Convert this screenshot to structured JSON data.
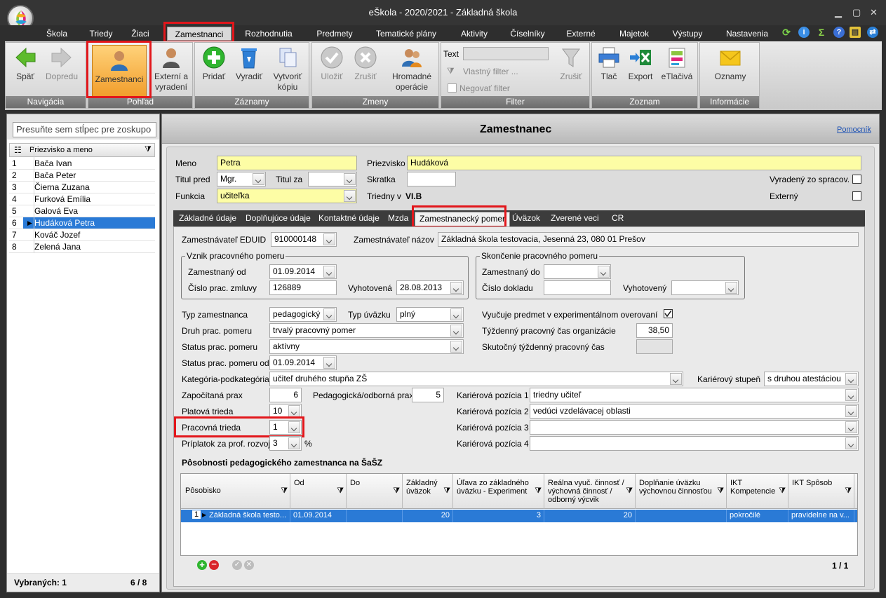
{
  "window": {
    "title": "eŠkola - 2020/2021 - Základná škola"
  },
  "menu": [
    "Škola",
    "Triedy",
    "Žiaci",
    "Zamestnanci",
    "Rozhodnutia",
    "Predmety",
    "Tematické plány",
    "Aktivity",
    "Číselníky",
    "Externé",
    "Majetok",
    "Výstupy",
    "Nastavenia"
  ],
  "ribbon": {
    "groups": [
      "Navigácia",
      "Pohľad",
      "Záznamy",
      "Zmeny",
      "Filter",
      "Zoznam",
      "Informácie"
    ],
    "back": "Späť",
    "forward": "Dopredu",
    "employees": "Zamestnanci",
    "external_line1": "Externí a",
    "external_line2": "vyradení",
    "add": "Pridať",
    "remove": "Vyradiť",
    "copy_line1": "Vytvoriť",
    "copy_line2": "kópiu",
    "save": "Uložiť",
    "cancel": "Zrušiť",
    "mass_line1": "Hromadné",
    "mass_line2": "operácie",
    "filter_text_label": "Text",
    "custom_filter": "Vlastný filter ...",
    "negate_filter": "Negovať filter",
    "filter_cancel": "Zrušiť",
    "print": "Tlač",
    "export": "Export",
    "eforms": "eTlačivá",
    "notices": "Oznamy"
  },
  "left": {
    "group_placeholder": "Presuňte sem stĺpec pre zoskupo",
    "column": "Priezvisko a meno",
    "rows": [
      {
        "n": "1",
        "name": "Bača Ivan"
      },
      {
        "n": "2",
        "name": "Bača Peter"
      },
      {
        "n": "3",
        "name": "Čierna Zuzana"
      },
      {
        "n": "4",
        "name": "Furková Emília"
      },
      {
        "n": "5",
        "name": "Galová Eva"
      },
      {
        "n": "6",
        "name": "Hudáková Petra"
      },
      {
        "n": "7",
        "name": "Kováč Jozef"
      },
      {
        "n": "8",
        "name": "Zelená Jana"
      }
    ],
    "selected_label": "Vybraných: 1",
    "count": "6 / 8"
  },
  "main": {
    "title": "Zamestnanec",
    "help": "Pomocník",
    "meno_label": "Meno",
    "meno": "Petra",
    "priezvisko_label": "Priezvisko",
    "priezvisko": "Hudáková",
    "titul_pred_label": "Titul pred",
    "titul_pred": "Mgr.",
    "titul_za_label": "Titul za",
    "titul_za": "",
    "skratka_label": "Skratka",
    "skratka": "",
    "vyradeny_label": "Vyradený zo spracov.",
    "funkcia_label": "Funkcia",
    "funkcia": "učiteľka",
    "triedny_label": "Triedny v",
    "triedny": "VI.B",
    "externy_label": "Externý",
    "tabs": [
      "Základné údaje",
      "Doplňujúce údaje",
      "Kontaktné údaje",
      "Mzda",
      "Zamestnanecký pomer",
      "Úväzok",
      "Zverené veci",
      "CR"
    ]
  },
  "form": {
    "eduid_label": "Zamestnávateľ EDUID",
    "eduid": "910000148",
    "employer_label": "Zamestnávateľ názov",
    "employer": "Základná škola testovacia, Jesenná 23, 080 01 Prešov",
    "origin_group": "Vznik pracovného pomeru",
    "employed_from_label": "Zamestnaný od",
    "employed_from": "01.09.2014",
    "contract_label": "Číslo prac. zmluvy",
    "contract": "126889",
    "issued_label": "Vyhotovená",
    "issued": "28.08.2013",
    "end_group": "Skončenie pracovného pomeru",
    "employed_to_label": "Zamestnaný do",
    "employed_to": "",
    "doc_label": "Číslo dokladu",
    "doc": "",
    "issued2_label": "Vyhotovený",
    "issued2": "",
    "type_label": "Typ zamestnanca",
    "type": "pedagogický",
    "load_type_label": "Typ úväzku",
    "load_type": "plný",
    "experimental_label": "Vyučuje predmet v experimentálnom overovaní",
    "kind_label": "Druh prac. pomeru",
    "kind": "trvalý pracovný pomer",
    "weekly_org_label": "Týždenný pracovný čas organizácie",
    "weekly_org": "38,50",
    "status_label": "Status prac. pomeru",
    "status": "aktívny",
    "weekly_real_label": "Skutočný týždenný pracovný čas",
    "weekly_real": "",
    "status_from_label": "Status prac. pomeru od",
    "status_from": "01.09.2014",
    "category_label": "Kategória-podkategória",
    "category": "učiteľ druhého stupňa ZŠ",
    "career_level_label": "Kariérový stupeň",
    "career_level": "s druhou atestáciou",
    "practice_label": "Započítaná prax",
    "practice": "6",
    "ped_practice_label": "Pedagogická/odborná prax",
    "ped_practice": "5",
    "pos1_label": "Kariérová pozícia 1",
    "pos1": "triedny učiteľ",
    "salary_class_label": "Platová trieda",
    "salary_class": "10",
    "pos2_label": "Kariérová pozícia 2",
    "pos2": "vedúci vzdelávacej oblasti",
    "work_class_label": "Pracovná trieda",
    "work_class": "1",
    "pos3_label": "Kariérová pozícia 3",
    "pos3": "",
    "bonus_label": "Príplatok za prof. rozvoj",
    "bonus": "3",
    "bonus_unit": "%",
    "pos4_label": "Kariérová pozícia 4",
    "pos4": ""
  },
  "grid": {
    "title": "Pôsobnosti pedagogického zamestnanca na ŠaŠZ",
    "headers": [
      "Pôsobisko",
      "Od",
      "Do",
      "Základný úväzok",
      "Úľava zo základného úväzku - Experiment",
      "Reálna vyuč. činnosť / výchovná činnosť / odborný výcvik",
      "Doplňanie úväzku výchovnou činnosťou",
      "IKT Kompetencie",
      "IKT Spôsob"
    ],
    "row": {
      "n": "1",
      "posobisko": "Základná škola testo...",
      "od": "01.09.2014",
      "do": "",
      "zakladny": "20",
      "ulava": "3",
      "realna": "20",
      "doplnanie": "",
      "ikt_komp": "pokročilé",
      "ikt_sposob": "pravidelne na v..."
    },
    "pager": "1 / 1"
  }
}
